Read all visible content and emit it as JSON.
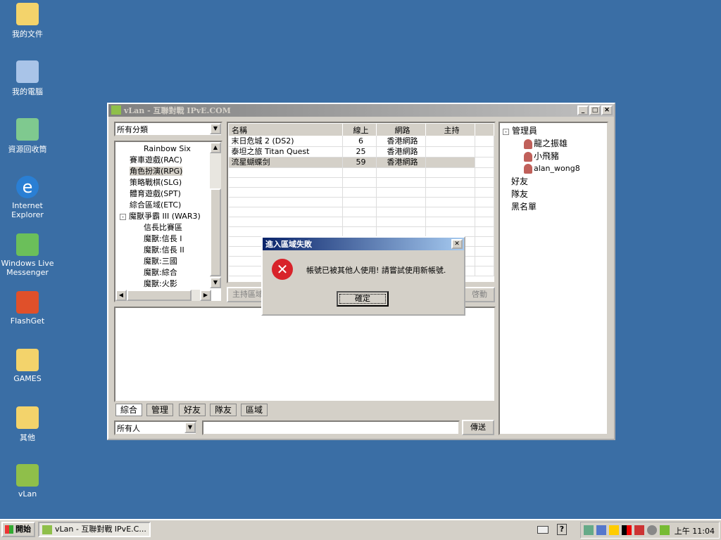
{
  "desktop": {
    "icons": [
      {
        "label": "我的文件"
      },
      {
        "label": "我的電腦"
      },
      {
        "label": "資源回收筒"
      },
      {
        "label": "Internet Explorer"
      },
      {
        "label": "Windows Live Messenger"
      },
      {
        "label": "FlashGet"
      },
      {
        "label": "GAMES"
      },
      {
        "label": "其他"
      },
      {
        "label": "vLan"
      }
    ]
  },
  "window": {
    "title": "vLan - 互聯對戰 IPvE.COM",
    "category_select": "所有分類",
    "tree": [
      "Rainbow Six",
      "賽車遊戲(RAC)",
      "角色扮演(RPG)",
      "策略戰棋(SLG)",
      "體育遊戲(SPT)",
      "綜合區域(ETC)",
      "魔獸爭霸 III (WAR3)",
      "信長比賽區",
      "魔獸:信長 I",
      "魔獸:信長 II",
      "魔獸:三國",
      "魔獸:綜合",
      "魔獸:火影"
    ],
    "table": {
      "headers": [
        "名稱",
        "線上",
        "網路",
        "主持"
      ],
      "rows": [
        [
          "末日危城 2 (DS2)",
          "6",
          "香港網路",
          ""
        ],
        [
          "泰坦之旅 Titan Quest",
          "25",
          "香港網路",
          ""
        ],
        [
          "流星蝴蝶剑",
          "59",
          "香港網路",
          ""
        ]
      ]
    },
    "host_button": "主持區域",
    "start_button": "啓動",
    "tabs": [
      "綜合",
      "管理",
      "好友",
      "隊友",
      "區域"
    ],
    "recipient_select": "所有人",
    "send_button": "傳送",
    "users": {
      "admin": "管理員",
      "admins": [
        "龍之振雄",
        "小飛豬",
        "alan_wong8"
      ],
      "friends": "好友",
      "team": "隊友",
      "blacklist": "黑名單"
    }
  },
  "dialog": {
    "title": "進入區域失敗",
    "message": "帳號已被其他人使用! 請嘗試使用新帳號.",
    "ok": "確定"
  },
  "taskbar": {
    "start": "開始",
    "task": "vLan - 互聯對戰 IPvE.C...",
    "clock": "上午 11:04"
  }
}
